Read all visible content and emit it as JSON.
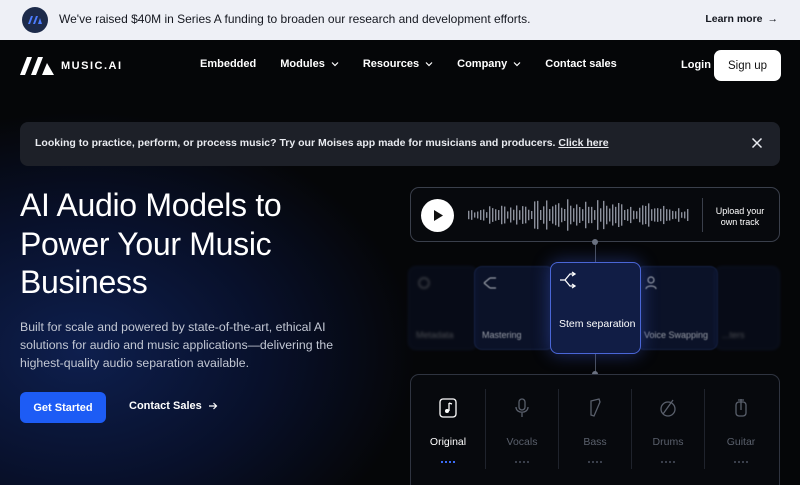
{
  "announcement": {
    "message": "We've raised $40M in Series A funding to broaden our research and development efforts.",
    "learn_more": "Learn more"
  },
  "nav": {
    "brand": "MUSIC.AI",
    "links": [
      {
        "label": "Embedded",
        "dropdown": false
      },
      {
        "label": "Modules",
        "dropdown": true
      },
      {
        "label": "Resources",
        "dropdown": true
      },
      {
        "label": "Company",
        "dropdown": true
      },
      {
        "label": "Contact sales",
        "dropdown": false
      }
    ],
    "login": "Login",
    "signup": "Sign up"
  },
  "banner": {
    "text": "Looking to practice, perform, or process music? Try our Moises app made for musicians and producers. ",
    "link": "Click here"
  },
  "hero": {
    "headline": "AI Audio Models to Power Your Music Business",
    "subtitle": "Built for scale and powered by state-of-the-art, ethical AI solutions for audio and music applications—delivering the highest-quality audio separation available.",
    "cta_primary": "Get Started",
    "cta_secondary": "Contact Sales"
  },
  "demo": {
    "upload": "Upload your own track",
    "modules": [
      {
        "label": "Metadata"
      },
      {
        "label": "Mastering"
      },
      {
        "label": "Stem separation"
      },
      {
        "label": "Voice Swapping"
      },
      {
        "label": "...ters"
      }
    ],
    "stems": [
      {
        "label": "Original",
        "active": true
      },
      {
        "label": "Vocals",
        "active": false
      },
      {
        "label": "Bass",
        "active": false
      },
      {
        "label": "Drums",
        "active": false
      },
      {
        "label": "Guitar",
        "active": false
      }
    ]
  },
  "colors": {
    "accent": "#1d5cf5",
    "banner_bg": "#1d2028",
    "announce_bg": "#eef0f6"
  }
}
